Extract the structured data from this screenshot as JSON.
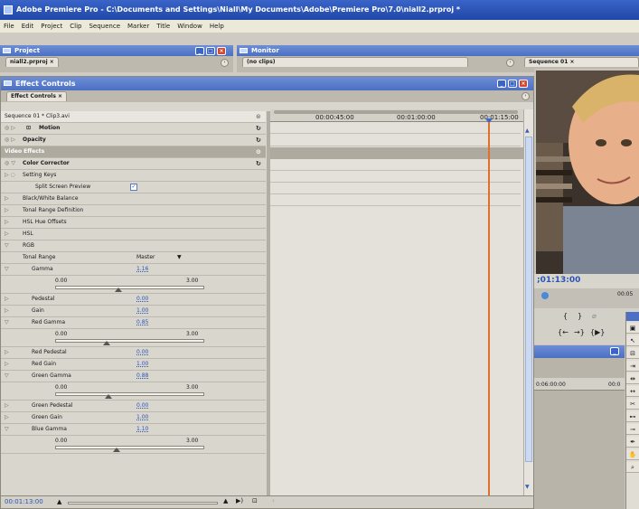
{
  "window": {
    "title": "Adobe Premiere Pro - C:\\Documents and Settings\\Niall\\My Documents\\Adobe\\Premiere Pro\\7.0\\niall2.prproj *"
  },
  "menu": [
    "File",
    "Edit",
    "Project",
    "Clip",
    "Sequence",
    "Marker",
    "Title",
    "Window",
    "Help"
  ],
  "project_panel": {
    "title": "Project",
    "tab": "niall2.prproj"
  },
  "monitor_panel": {
    "title": "Monitor",
    "source_tab": "(no clips)",
    "program_tab": "Sequence 01"
  },
  "effect_controls": {
    "title": "Effect Controls",
    "tab": "Effect Controls",
    "clip_label": "Sequence 01 * Clip3.avi",
    "timecodes": [
      "00:00:45:00",
      "00:01:00:00",
      "00:01:15:00"
    ],
    "current_time": "00:01:13:00",
    "rows": {
      "motion": "Motion",
      "opacity": "Opacity",
      "video_effects": "Video Effects",
      "color_corrector": "Color Corrector",
      "setting_keys": "Setting Keys",
      "split_screen": "Split Screen Preview",
      "bw_balance": "Black/White Balance",
      "tonal_range_def": "Tonal Range Definition",
      "hsl_hue": "HSL Hue Offsets",
      "hsl": "HSL",
      "rgb": "RGB",
      "tonal_range": "Tonal Range",
      "tonal_range_value": "Master",
      "gamma": "Gamma",
      "gamma_value": "1.16",
      "pedestal": "Pedestal",
      "pedestal_value": "0.00",
      "gain": "Gain",
      "gain_value": "1.00",
      "red_gamma": "Red Gamma",
      "red_gamma_value": "0.85",
      "red_pedestal": "Red Pedestal",
      "red_pedestal_value": "0.00",
      "red_gain": "Red Gain",
      "red_gain_value": "1.00",
      "green_gamma": "Green Gamma",
      "green_gamma_value": "0.88",
      "green_pedestal": "Green Pedestal",
      "green_pedestal_value": "0.00",
      "green_gain": "Green Gain",
      "green_gain_value": "1.00",
      "blue_gamma": "Blue Gamma",
      "blue_gamma_value": "1.10",
      "slider_min": "0.00",
      "slider_max": "3.00"
    }
  },
  "program_monitor": {
    "timecode": ";01:13:00",
    "ruler_time": "00:05",
    "timeline_time": "0:06:00:00",
    "timeline_time2": "00:0"
  }
}
